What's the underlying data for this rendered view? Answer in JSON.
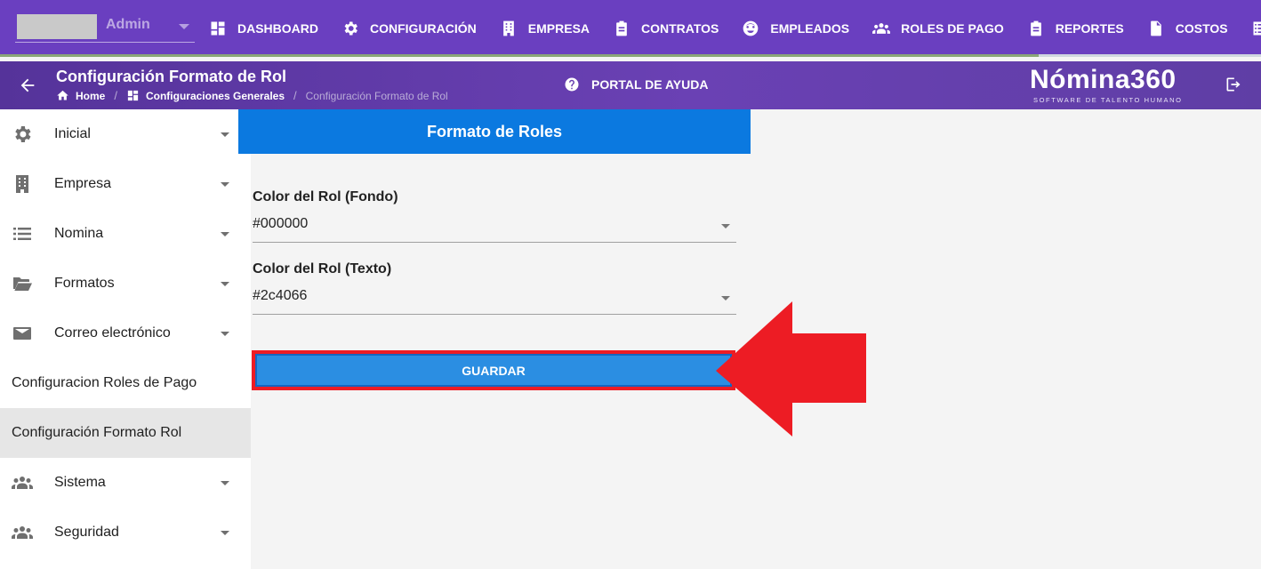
{
  "topbar": {
    "user": {
      "name": "Admin"
    },
    "nav": [
      {
        "label": "DASHBOARD",
        "icon": "dashboard-icon"
      },
      {
        "label": "CONFIGURACIÓN",
        "icon": "gear-icon"
      },
      {
        "label": "EMPRESA",
        "icon": "building-icon"
      },
      {
        "label": "CONTRATOS",
        "icon": "clipboard-icon"
      },
      {
        "label": "EMPLEADOS",
        "icon": "face-icon"
      },
      {
        "label": "ROLES DE PAGO",
        "icon": "users-icon"
      },
      {
        "label": "REPORTES",
        "icon": "clipboard-icon"
      },
      {
        "label": "COSTOS",
        "icon": "dollar-file-icon"
      },
      {
        "label": "",
        "icon": "list-icon"
      }
    ]
  },
  "subheader": {
    "title": "Configuración Formato de Rol",
    "breadcrumb": {
      "home": "Home",
      "section": "Configuraciones Generales",
      "current": "Configuración Formato de Rol"
    },
    "help_label": "PORTAL DE AYUDA",
    "brand": {
      "name": "Nómina360",
      "tagline": "SOFTWARE DE TALENTO HUMANO"
    }
  },
  "sidebar": {
    "items": [
      {
        "label": "Inicial",
        "icon": "gear-icon"
      },
      {
        "label": "Empresa",
        "icon": "building-icon"
      },
      {
        "label": "Nomina",
        "icon": "list-icon"
      },
      {
        "label": "Formatos",
        "icon": "folder-open-icon"
      },
      {
        "label": "Correo electrónico",
        "icon": "mail-icon"
      },
      {
        "label": "Configuracion Roles de Pago"
      },
      {
        "label": "Configuración Formato Rol"
      },
      {
        "label": "Sistema",
        "icon": "users-icon"
      },
      {
        "label": "Seguridad",
        "icon": "users-icon"
      }
    ]
  },
  "main": {
    "panel_title": "Formato de Roles",
    "fields": [
      {
        "label": "Color del Rol (Fondo)",
        "value": "#000000"
      },
      {
        "label": "Color del Rol (Texto)",
        "value": "#2c4066"
      }
    ],
    "save_label": "GUARDAR"
  },
  "colors": {
    "topbar": "#6a3fc0",
    "panel_header": "#0b79e0",
    "save_button": "#2b8ee2",
    "highlight": "#ed1c24"
  }
}
